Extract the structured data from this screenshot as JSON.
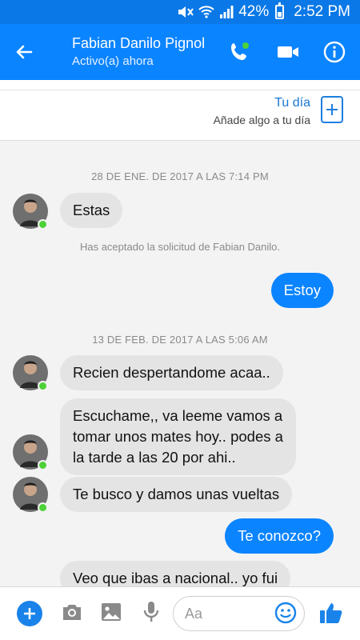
{
  "status_bar": {
    "battery": "42%",
    "time": "2:52 PM"
  },
  "header": {
    "contact_name": "Fabian Danilo Pignol",
    "contact_status": "Activo(a) ahora"
  },
  "your_day": {
    "title": "Tu día",
    "subtitle": "Añade algo a tu día"
  },
  "messages": [
    {
      "kind": "timestamp",
      "text": "28 DE ENE. DE 2017 A LAS 7:14 PM"
    },
    {
      "kind": "incoming",
      "text": "Estas"
    },
    {
      "kind": "notice",
      "text": "Has aceptado la solicitud de Fabian Danilo."
    },
    {
      "kind": "outgoing",
      "text": "Estoy"
    },
    {
      "kind": "timestamp",
      "text": "13 DE FEB. DE 2017 A LAS 5:06 AM"
    },
    {
      "kind": "incoming",
      "text": "Recien despertandome acaa.."
    },
    {
      "kind": "incoming",
      "lines": [
        "Escuchame,, va leeme vamos a",
        "tomar unos mates hoy.. podes a",
        "la tarde a las 20 por ahi.."
      ]
    },
    {
      "kind": "incoming",
      "text": "Te busco y damos unas vueltas"
    },
    {
      "kind": "outgoing",
      "text": "Te conozco?"
    },
    {
      "kind": "incoming",
      "text": "Veo que ibas a nacional.. yo fui"
    }
  ],
  "composer": {
    "placeholder": "Aa"
  },
  "colors": {
    "brand": "#0b84ff",
    "incoming_bubble": "#e4e4e4",
    "online": "#4cd137"
  }
}
